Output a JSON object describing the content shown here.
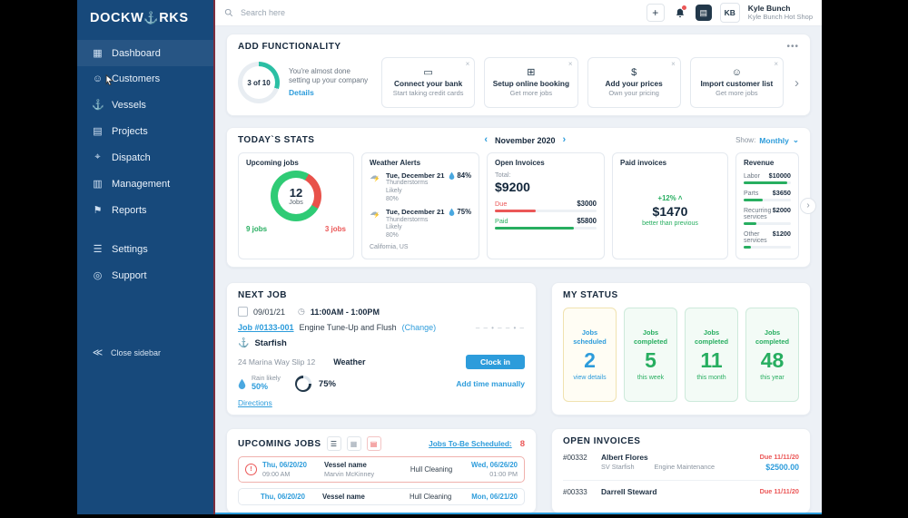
{
  "colors": {
    "accent_blue": "#2d9cdb",
    "green": "#27ae60",
    "red": "#eb5757",
    "sidebar_blue": "#17497b"
  },
  "sidebar": {
    "logo": {
      "pre": "DOCKW",
      "anchor": "⚓",
      "post": "RKS"
    },
    "items": [
      {
        "label": "Dashboard",
        "icon": "▦"
      },
      {
        "label": "Customers",
        "icon": "☺"
      },
      {
        "label": "Vessels",
        "icon": "⚓"
      },
      {
        "label": "Projects",
        "icon": "▤"
      },
      {
        "label": "Dispatch",
        "icon": "⌖"
      },
      {
        "label": "Management",
        "icon": "▥"
      },
      {
        "label": "Reports",
        "icon": "⚑"
      }
    ],
    "secondary": [
      {
        "label": "Settings",
        "icon": "☰"
      },
      {
        "label": "Support",
        "icon": "◎"
      }
    ],
    "close_icon": "≪",
    "close_label": "Close sidebar"
  },
  "topbar": {
    "search_placeholder": "Search here",
    "plus_icon": "+",
    "task_icon": "▤",
    "user_initials": "KB",
    "user_name": "Kyle Bunch",
    "user_company": "Kyle Bunch Hot Shop"
  },
  "add_functionality": {
    "title": "ADD FUNCTIONALITY",
    "menu_icon": "•••",
    "progress_label": "3 of 10",
    "progress_pct": 30,
    "message": "You're almost done setting up your company",
    "details_label": "Details",
    "close_icon": "×",
    "next_icon": "›",
    "cards": [
      {
        "icon": "▭",
        "title": "Connect your bank",
        "subtitle": "Start taking credit cards"
      },
      {
        "icon": "⊞",
        "title": "Setup online booking",
        "subtitle": "Get more jobs"
      },
      {
        "icon": "$",
        "title": "Add your prices",
        "subtitle": "Own your pricing"
      },
      {
        "icon": "☺",
        "title": "Import customer list",
        "subtitle": "Get more jobs"
      }
    ]
  },
  "stats": {
    "title": "TODAY`S STATS",
    "prev_icon": "‹",
    "next_icon": "›",
    "month": "November 2020",
    "show_label": "Show:",
    "show_value": "Monthly",
    "show_caret": "⌄",
    "upcoming_jobs": {
      "title": "Upcoming jobs",
      "count": "12",
      "unit": "Jobs",
      "done": "9 jobs",
      "late": "3 jobs",
      "green_pct": 75,
      "red_pct": 25
    },
    "weather": {
      "title": "Weather Alerts",
      "cloud_icon": "☁",
      "bolt_icon": "⚡",
      "entries": [
        {
          "date": "Tue, December 21",
          "condition": "Thunderstorms Likely",
          "chance": "80%",
          "humidity": "84%"
        },
        {
          "date": "Tue, December 21",
          "condition": "Thunderstorms Likely",
          "chance": "80%",
          "humidity": "75%"
        }
      ],
      "location": "California, US"
    },
    "open_invoices": {
      "title": "Open Invoices",
      "total_label": "Total:",
      "total": "$9200",
      "due_label": "Due",
      "due_value": "$3000",
      "due_pct": 40,
      "paid_label": "Paid",
      "paid_value": "$5800",
      "paid_pct": 78
    },
    "paid_invoices": {
      "title": "Paid invoices",
      "change": "+12% ˄",
      "amount": "$1470",
      "note": "better than previous"
    },
    "revenue": {
      "title": "Revenue",
      "rows": [
        {
          "label": "Labor",
          "value": "$10000",
          "pct": 92
        },
        {
          "label": "Parts",
          "value": "$3650",
          "pct": 40
        },
        {
          "label": "Recurring services",
          "value": "$2000",
          "pct": 26
        },
        {
          "label": "Other services",
          "value": "$1200",
          "pct": 16
        }
      ]
    }
  },
  "next_job": {
    "title": "NEXT JOB",
    "date": "09/01/21",
    "clock_icon": "◷",
    "time": "11:00AM - 1:00PM",
    "job_link": "Job #0133-001",
    "job_desc": "Engine Tune-Up and Flush",
    "change_label": "(Change)",
    "timeline": "– – • – – • –",
    "anchor_icon": "⚓",
    "vessel": "Starfish",
    "address": "24 Marina Way Slip 12",
    "weather_label": "Weather",
    "rain_label": "Rain likely",
    "rain_value": "50%",
    "gauge_value": "75%",
    "gauge_pct": 75,
    "clock_in_label": "Clock in",
    "add_time_label": "Add time manually",
    "directions_label": "Directions"
  },
  "my_status": {
    "title": "MY STATUS",
    "tiles": [
      {
        "label": "Jobs scheduled",
        "value": "2",
        "sub": "view details"
      },
      {
        "label": "Jobs completed",
        "value": "5",
        "sub": "this week"
      },
      {
        "label": "Jobs completed",
        "value": "11",
        "sub": "this month"
      },
      {
        "label": "Jobs completed",
        "value": "48",
        "sub": "this year"
      }
    ]
  },
  "upcoming_jobs": {
    "title": "UPCOMING JOBS",
    "list_icon": "☰",
    "grid_icon": "▦",
    "doc_icon": "▤",
    "alert_icon": "!",
    "to_be_scheduled_label": "Jobs To-Be Scheduled:",
    "to_be_scheduled_count": "8",
    "rows": [
      {
        "date": "Thu, 06/20/20",
        "time": "09:00 AM",
        "vessel": "Vessel name",
        "customer": "Marvin McKinney",
        "service": "Hull Cleaning",
        "due_date": "Wed, 06/26/20",
        "due_time": "01:00 PM"
      },
      {
        "date": "Thu, 06/20/20",
        "time": "",
        "vessel": "Vessel name",
        "customer": "",
        "service": "Hull Cleaning",
        "due_date": "Mon, 06/21/20",
        "due_time": ""
      }
    ]
  },
  "open_invoices": {
    "title": "OPEN INVOICES",
    "rows": [
      {
        "id": "#00332",
        "customer": "Albert Flores",
        "vessel": "SV Starfish",
        "service": "Engine Maintenance",
        "due": "Due 11/11/20",
        "amount": "$2500.00"
      },
      {
        "id": "#00333",
        "customer": "Darrell Steward",
        "vessel": "",
        "service": "",
        "due": "Due 11/11/20",
        "amount": ""
      }
    ]
  }
}
